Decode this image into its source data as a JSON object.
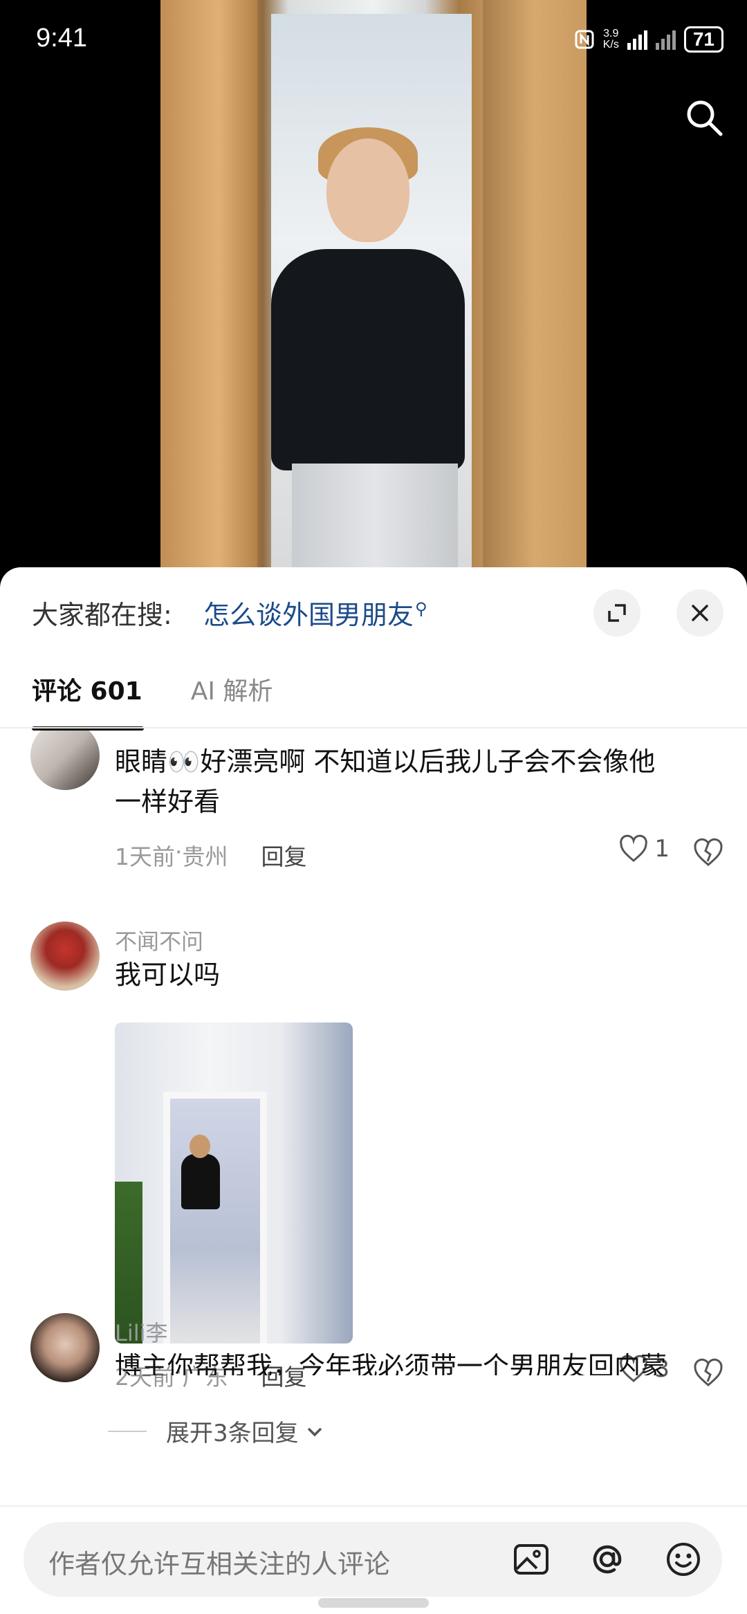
{
  "status_bar": {
    "time": "9:41",
    "speed": "3.9",
    "speed_unit": "K/s",
    "battery": "71"
  },
  "sheet": {
    "hot_search_prefix": "大家都在搜:",
    "hot_search_query": "怎么谈外国男朋友",
    "tabs": [
      {
        "label": "评论 601",
        "active": true
      },
      {
        "label": "AI 解析",
        "active": false
      }
    ]
  },
  "comments": [
    {
      "text_line1": "眼睛👀好漂亮啊 不知道以后我儿子会不会像他",
      "text_line2": "一样好看",
      "time": "1天前",
      "location": "贵州",
      "reply": "回复",
      "likes": "1"
    },
    {
      "name": "不闻不问",
      "text": "我可以吗",
      "time": "2天前",
      "location": "广东",
      "reply": "回复",
      "likes": "3",
      "expand": "展开3条回复"
    },
    {
      "name": "Lili李",
      "text": "博主你帮帮我，今年我必须带一个男朋友回内蒙"
    }
  ],
  "meta_separator": " · ",
  "composer": {
    "placeholder": "作者仅允许互相关注的人评论"
  },
  "icons": [
    "search-icon",
    "expand-icon",
    "close-icon",
    "heart-icon",
    "broken-heart-icon",
    "chevron-down-icon",
    "image-icon",
    "at-icon",
    "emoji-icon"
  ]
}
